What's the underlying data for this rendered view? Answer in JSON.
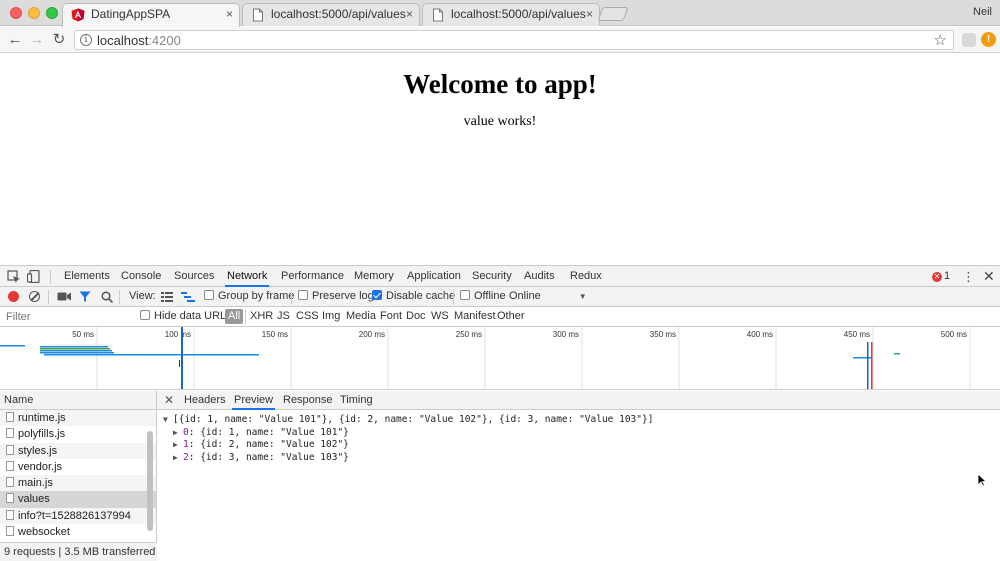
{
  "browser": {
    "tabs": [
      {
        "title": "DatingAppSPA",
        "active": true
      },
      {
        "title": "localhost:5000/api/values",
        "active": false
      },
      {
        "title": "localhost:5000/api/values",
        "active": false
      }
    ],
    "close_glyph": "×",
    "profile_name": "Neil",
    "url_host": "localhost",
    "url_port": ":4200",
    "colors": {
      "angular_red": "#dd1b16",
      "accent_blue": "#1a73e8"
    }
  },
  "page": {
    "heading": "Welcome to app!",
    "message": "value works!"
  },
  "devtools": {
    "tabs": [
      "Elements",
      "Console",
      "Sources",
      "Network",
      "Performance",
      "Memory",
      "Application",
      "Security",
      "Audits",
      "Redux"
    ],
    "active_tab": "Network",
    "error_count": "1",
    "network_toolbar": {
      "view_label": "View:",
      "group_by_frame": "Group by frame",
      "preserve_log": "Preserve log",
      "disable_cache": "Disable cache",
      "disable_cache_checked": true,
      "offline": "Offline",
      "throttle": "Online"
    },
    "filter": {
      "placeholder": "Filter",
      "hide_data_urls": "Hide data URLs",
      "types": [
        "All",
        "XHR",
        "JS",
        "CSS",
        "Img",
        "Media",
        "Font",
        "Doc",
        "WS",
        "Manifest",
        "Other"
      ],
      "active_type": "All"
    },
    "timeline": {
      "ticks": [
        "50 ms",
        "100 ms",
        "150 ms",
        "200 ms",
        "250 ms",
        "300 ms",
        "350 ms",
        "400 ms",
        "450 ms",
        "500 ms"
      ]
    },
    "requests": {
      "header": "Name",
      "items": [
        "runtime.js",
        "polyfills.js",
        "styles.js",
        "vendor.js",
        "main.js",
        "values",
        "info?t=1528826137994",
        "websocket"
      ],
      "selected": "values",
      "status": "9 requests | 3.5 MB transferred | ..."
    },
    "detail": {
      "tabs": [
        "Headers",
        "Preview",
        "Response",
        "Timing"
      ],
      "active_tab": "Preview",
      "preview_root": "[{id: 1, name: \"Value 101\"}, {id: 2, name: \"Value 102\"}, {id: 3, name: \"Value 103\"}]",
      "preview_items": [
        {
          "key": "0",
          "value": "{id: 1, name: \"Value 101\"}"
        },
        {
          "key": "1",
          "value": "{id: 2, name: \"Value 102\"}"
        },
        {
          "key": "2",
          "value": "{id: 3, name: \"Value 103\"}"
        }
      ]
    }
  }
}
